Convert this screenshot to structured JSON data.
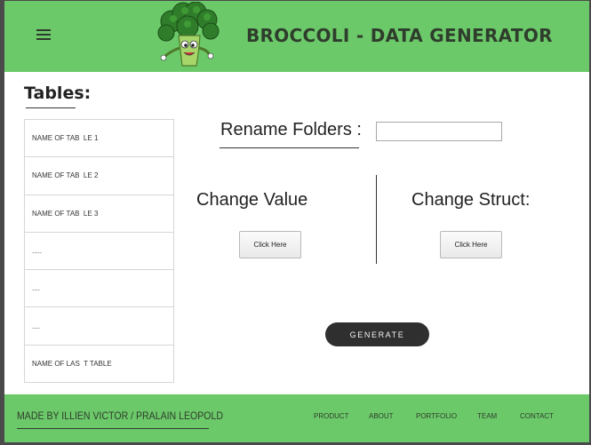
{
  "header": {
    "title": "BROCCOLI - DATA GENERATOR",
    "logo": "broccoli-mascot",
    "menu_icon": "hamburger-icon",
    "background": "#6cc96a"
  },
  "tables": {
    "heading": "Tables:",
    "items": [
      "NAME OF TAB  LE 1",
      "NAME OF TAB  LE 2",
      "NAME OF TAB  LE 3",
      ".....",
      "....",
      "....",
      "NAME OF LAS  T TABLE"
    ]
  },
  "rename": {
    "label": "Rename Folders :",
    "input_value": ""
  },
  "change_value": {
    "title": "Change Value",
    "button": "Click Here"
  },
  "change_structure": {
    "title": "Change Struct:",
    "button": "Click Here"
  },
  "generate": {
    "label": "GENERATE"
  },
  "footer": {
    "credit": "MADE BY ILLIEN VICTOR / PRALAIN LEOPOLD",
    "nav": [
      "PRODUCT",
      "ABOUT",
      "PORTFOLIO",
      "TEAM",
      "CONTACT"
    ]
  }
}
